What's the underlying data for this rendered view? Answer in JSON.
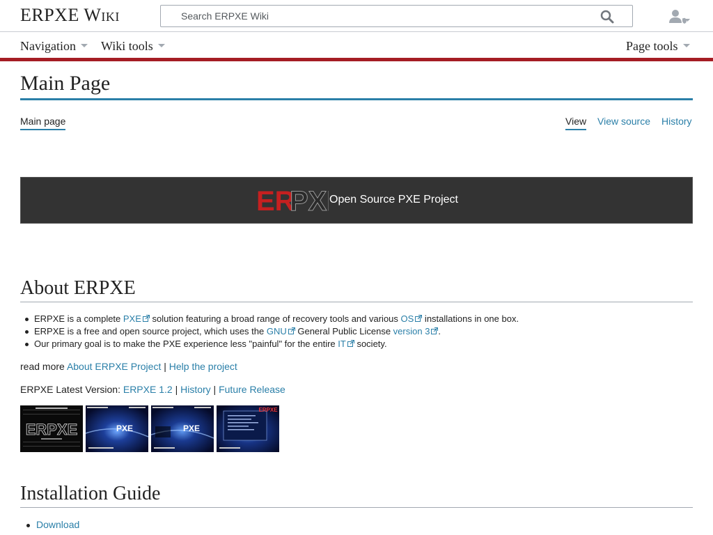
{
  "header": {
    "logo": "ERPXE Wiki",
    "search_placeholder": "Search ERPXE Wiki",
    "search_icon": "magnifier-icon",
    "user_icon": "user-icon"
  },
  "nav": {
    "navigation": "Navigation",
    "wiki_tools": "Wiki tools",
    "page_tools": "Page tools"
  },
  "page": {
    "title": "Main Page",
    "tabs": {
      "main": "Main page",
      "view": "View",
      "view_source": "View source",
      "history": "History"
    }
  },
  "banner": {
    "logo_text": "ERPXE",
    "text": "Open Source PXE Project"
  },
  "about": {
    "heading": "About ERPXE",
    "b1": {
      "t1": "ERPXE is a complete ",
      "l1": "PXE",
      "t2": " solution featuring a broad range of recovery tools and various ",
      "l2": "OS",
      "t3": " installations in one box."
    },
    "b2": {
      "t1": "ERPXE is a free and open source project, which uses the ",
      "l1": "GNU",
      "t2": " General Public License ",
      "l2": "version 3",
      "t3": "."
    },
    "b3": {
      "t1": "Our primary goal is to make the PXE experience less \"painful\" for the entire ",
      "l1": "IT",
      "t2": " society."
    },
    "readmore": {
      "prefix": "read more ",
      "link1": "About ERPXE Project",
      "sep": " | ",
      "link2": "Help the project"
    },
    "latest": {
      "prefix": "ERPXE Latest Version: ",
      "link1": "ERPXE 1.2",
      "sep1": " | ",
      "link2": "History",
      "sep2": " | ",
      "link3": "Future Release"
    }
  },
  "thumbnails": [
    {
      "caption": "ERPXE"
    },
    {
      "caption": "PXE"
    },
    {
      "caption": "PXE"
    },
    {
      "caption": "ERPXE"
    }
  ],
  "install": {
    "heading": "Installation Guide",
    "items": [
      "Download"
    ]
  },
  "colors": {
    "link": "#2a7fa8",
    "accent_bar": "#a51d24",
    "title_rule": "#2a7fa8",
    "banner_bg": "#333333"
  }
}
